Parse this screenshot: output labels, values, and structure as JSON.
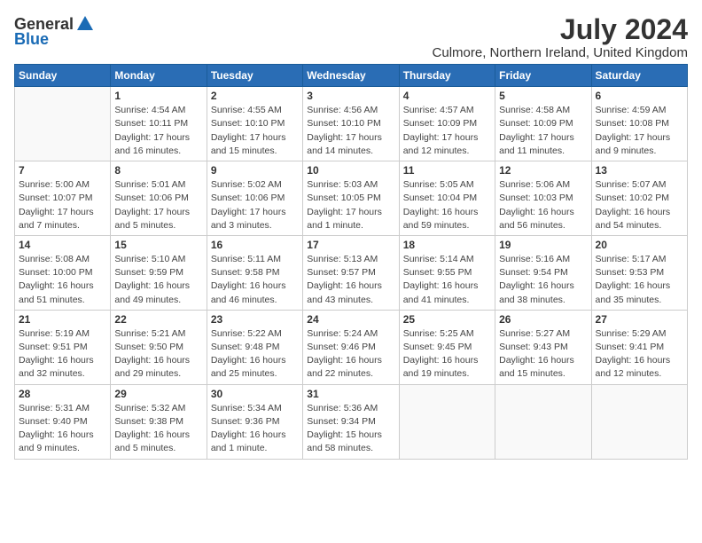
{
  "logo": {
    "general": "General",
    "blue": "Blue"
  },
  "title": {
    "month": "July 2024",
    "location": "Culmore, Northern Ireland, United Kingdom"
  },
  "headers": [
    "Sunday",
    "Monday",
    "Tuesday",
    "Wednesday",
    "Thursday",
    "Friday",
    "Saturday"
  ],
  "weeks": [
    [
      {
        "day": "",
        "info": ""
      },
      {
        "day": "1",
        "info": "Sunrise: 4:54 AM\nSunset: 10:11 PM\nDaylight: 17 hours\nand 16 minutes."
      },
      {
        "day": "2",
        "info": "Sunrise: 4:55 AM\nSunset: 10:10 PM\nDaylight: 17 hours\nand 15 minutes."
      },
      {
        "day": "3",
        "info": "Sunrise: 4:56 AM\nSunset: 10:10 PM\nDaylight: 17 hours\nand 14 minutes."
      },
      {
        "day": "4",
        "info": "Sunrise: 4:57 AM\nSunset: 10:09 PM\nDaylight: 17 hours\nand 12 minutes."
      },
      {
        "day": "5",
        "info": "Sunrise: 4:58 AM\nSunset: 10:09 PM\nDaylight: 17 hours\nand 11 minutes."
      },
      {
        "day": "6",
        "info": "Sunrise: 4:59 AM\nSunset: 10:08 PM\nDaylight: 17 hours\nand 9 minutes."
      }
    ],
    [
      {
        "day": "7",
        "info": "Sunrise: 5:00 AM\nSunset: 10:07 PM\nDaylight: 17 hours\nand 7 minutes."
      },
      {
        "day": "8",
        "info": "Sunrise: 5:01 AM\nSunset: 10:06 PM\nDaylight: 17 hours\nand 5 minutes."
      },
      {
        "day": "9",
        "info": "Sunrise: 5:02 AM\nSunset: 10:06 PM\nDaylight: 17 hours\nand 3 minutes."
      },
      {
        "day": "10",
        "info": "Sunrise: 5:03 AM\nSunset: 10:05 PM\nDaylight: 17 hours\nand 1 minute."
      },
      {
        "day": "11",
        "info": "Sunrise: 5:05 AM\nSunset: 10:04 PM\nDaylight: 16 hours\nand 59 minutes."
      },
      {
        "day": "12",
        "info": "Sunrise: 5:06 AM\nSunset: 10:03 PM\nDaylight: 16 hours\nand 56 minutes."
      },
      {
        "day": "13",
        "info": "Sunrise: 5:07 AM\nSunset: 10:02 PM\nDaylight: 16 hours\nand 54 minutes."
      }
    ],
    [
      {
        "day": "14",
        "info": "Sunrise: 5:08 AM\nSunset: 10:00 PM\nDaylight: 16 hours\nand 51 minutes."
      },
      {
        "day": "15",
        "info": "Sunrise: 5:10 AM\nSunset: 9:59 PM\nDaylight: 16 hours\nand 49 minutes."
      },
      {
        "day": "16",
        "info": "Sunrise: 5:11 AM\nSunset: 9:58 PM\nDaylight: 16 hours\nand 46 minutes."
      },
      {
        "day": "17",
        "info": "Sunrise: 5:13 AM\nSunset: 9:57 PM\nDaylight: 16 hours\nand 43 minutes."
      },
      {
        "day": "18",
        "info": "Sunrise: 5:14 AM\nSunset: 9:55 PM\nDaylight: 16 hours\nand 41 minutes."
      },
      {
        "day": "19",
        "info": "Sunrise: 5:16 AM\nSunset: 9:54 PM\nDaylight: 16 hours\nand 38 minutes."
      },
      {
        "day": "20",
        "info": "Sunrise: 5:17 AM\nSunset: 9:53 PM\nDaylight: 16 hours\nand 35 minutes."
      }
    ],
    [
      {
        "day": "21",
        "info": "Sunrise: 5:19 AM\nSunset: 9:51 PM\nDaylight: 16 hours\nand 32 minutes."
      },
      {
        "day": "22",
        "info": "Sunrise: 5:21 AM\nSunset: 9:50 PM\nDaylight: 16 hours\nand 29 minutes."
      },
      {
        "day": "23",
        "info": "Sunrise: 5:22 AM\nSunset: 9:48 PM\nDaylight: 16 hours\nand 25 minutes."
      },
      {
        "day": "24",
        "info": "Sunrise: 5:24 AM\nSunset: 9:46 PM\nDaylight: 16 hours\nand 22 minutes."
      },
      {
        "day": "25",
        "info": "Sunrise: 5:25 AM\nSunset: 9:45 PM\nDaylight: 16 hours\nand 19 minutes."
      },
      {
        "day": "26",
        "info": "Sunrise: 5:27 AM\nSunset: 9:43 PM\nDaylight: 16 hours\nand 15 minutes."
      },
      {
        "day": "27",
        "info": "Sunrise: 5:29 AM\nSunset: 9:41 PM\nDaylight: 16 hours\nand 12 minutes."
      }
    ],
    [
      {
        "day": "28",
        "info": "Sunrise: 5:31 AM\nSunset: 9:40 PM\nDaylight: 16 hours\nand 9 minutes."
      },
      {
        "day": "29",
        "info": "Sunrise: 5:32 AM\nSunset: 9:38 PM\nDaylight: 16 hours\nand 5 minutes."
      },
      {
        "day": "30",
        "info": "Sunrise: 5:34 AM\nSunset: 9:36 PM\nDaylight: 16 hours\nand 1 minute."
      },
      {
        "day": "31",
        "info": "Sunrise: 5:36 AM\nSunset: 9:34 PM\nDaylight: 15 hours\nand 58 minutes."
      },
      {
        "day": "",
        "info": ""
      },
      {
        "day": "",
        "info": ""
      },
      {
        "day": "",
        "info": ""
      }
    ]
  ]
}
